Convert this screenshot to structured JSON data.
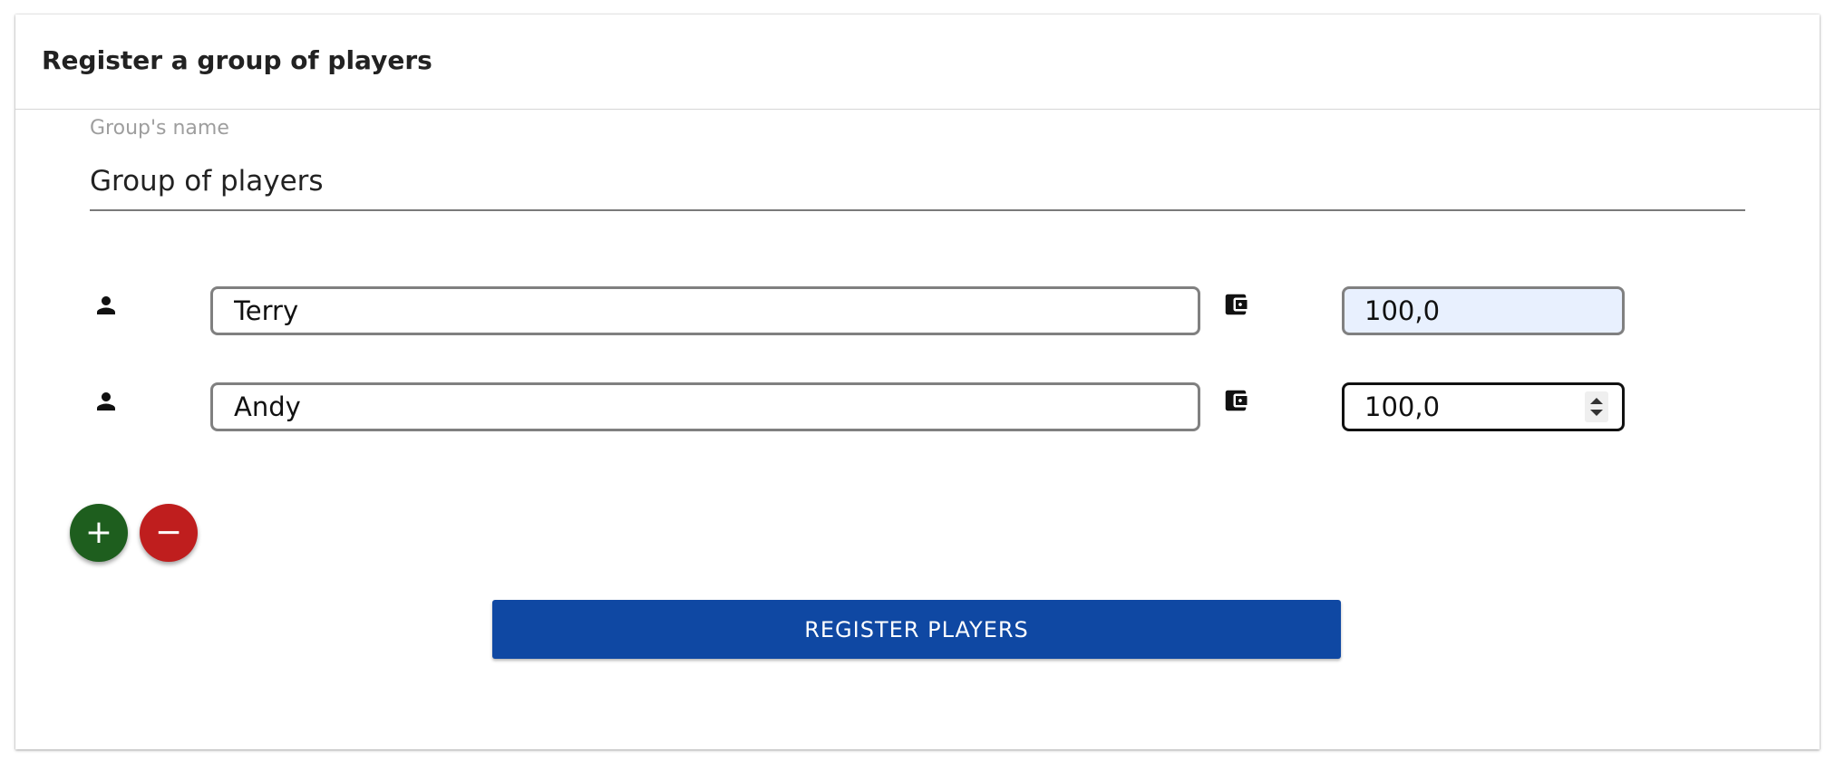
{
  "header": {
    "title": "Register a group of players"
  },
  "group": {
    "label": "Group's name",
    "value": "Group of players"
  },
  "players": [
    {
      "icon": "person-icon",
      "name": "Terry",
      "wallet_icon": "wallet-icon",
      "amount": "100,0"
    },
    {
      "icon": "person-icon",
      "name": "Andy",
      "wallet_icon": "wallet-icon",
      "amount": "100,0"
    }
  ],
  "buttons": {
    "add_symbol": "+",
    "remove_symbol": "−",
    "register_label": "REGISTER PLAYERS"
  },
  "colors": {
    "add": "#1e5e1e",
    "remove": "#bf1e1e",
    "register": "#0f48a3",
    "autofill": "#e8f0fe"
  }
}
